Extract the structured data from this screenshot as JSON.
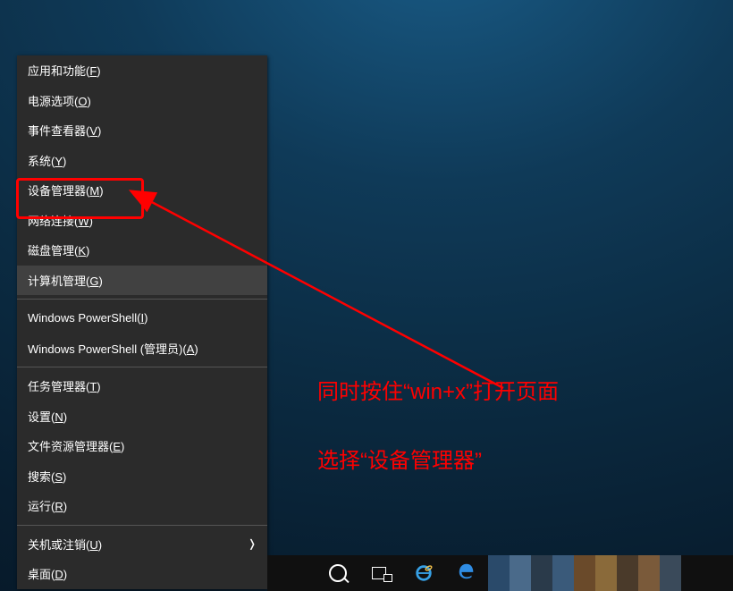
{
  "menu": {
    "items": [
      {
        "label": "应用和功能",
        "accel": "F"
      },
      {
        "label": "电源选项",
        "accel": "O"
      },
      {
        "label": "事件查看器",
        "accel": "V"
      },
      {
        "label": "系统",
        "accel": "Y"
      },
      {
        "label": "设备管理器",
        "accel": "M"
      },
      {
        "label": "网络连接",
        "accel": "W"
      },
      {
        "label": "磁盘管理",
        "accel": "K"
      },
      {
        "label": "计算机管理",
        "accel": "G"
      }
    ],
    "items2": [
      {
        "label": "Windows PowerShell",
        "accel": "I"
      },
      {
        "label": "Windows PowerShell (管理员)",
        "accel": "A"
      }
    ],
    "items3": [
      {
        "label": "任务管理器",
        "accel": "T"
      },
      {
        "label": "设置",
        "accel": "N"
      },
      {
        "label": "文件资源管理器",
        "accel": "E"
      },
      {
        "label": "搜索",
        "accel": "S"
      },
      {
        "label": "运行",
        "accel": "R"
      }
    ],
    "items4": [
      {
        "label": "关机或注销",
        "accel": "U",
        "submenu": true
      },
      {
        "label": "桌面",
        "accel": "D"
      }
    ],
    "hovered_index": 7
  },
  "annotations": {
    "line1": "同时按住“win+x”打开页面",
    "line2": "选择“设备管理器”"
  },
  "taskbar": {
    "tile_colors": [
      "#2a4a6a",
      "#4a6a8a",
      "#2a3a4a",
      "#3a5a7a",
      "#6a4a2a",
      "#8a6a3a",
      "#4a3a2a",
      "#7a5a3a",
      "#3a4a5a"
    ]
  }
}
